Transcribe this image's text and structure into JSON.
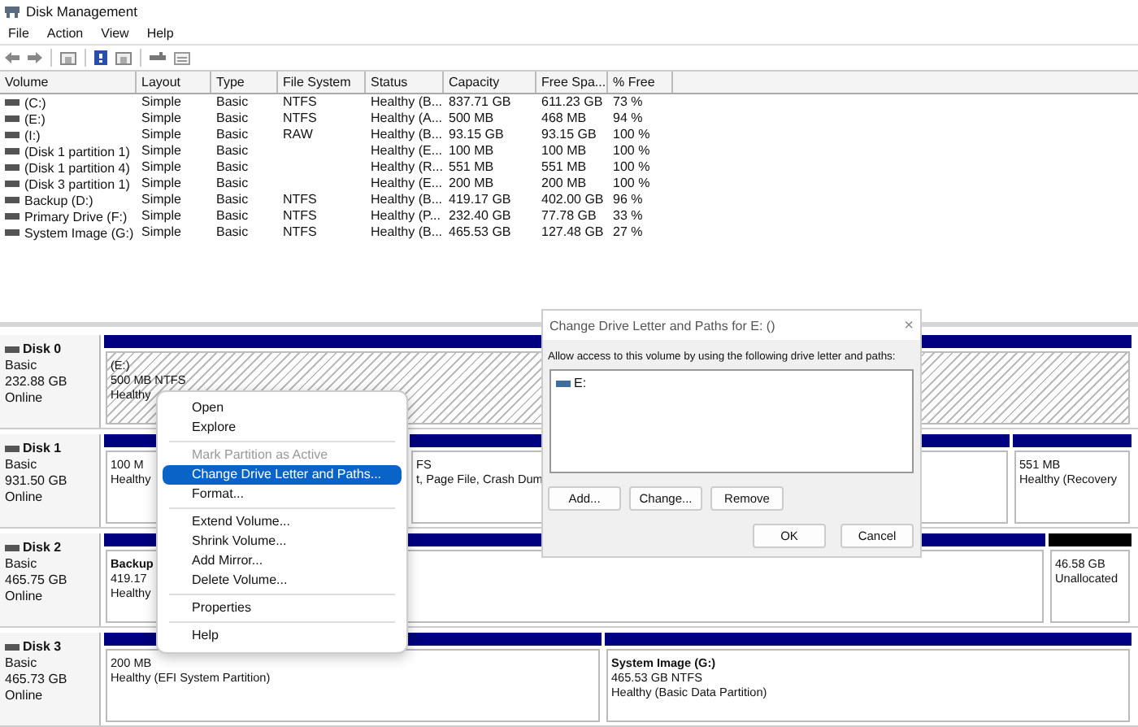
{
  "window": {
    "title": "Disk Management"
  },
  "menu": [
    "File",
    "Action",
    "View",
    "Help"
  ],
  "table": {
    "columns": [
      "Volume",
      "Layout",
      "Type",
      "File System",
      "Status",
      "Capacity",
      "Free Spa...",
      "% Free"
    ],
    "rows": [
      [
        "(C:)",
        "Simple",
        "Basic",
        "NTFS",
        "Healthy (B...",
        "837.71 GB",
        "611.23 GB",
        "73 %"
      ],
      [
        "(E:)",
        "Simple",
        "Basic",
        "NTFS",
        "Healthy (A...",
        "500 MB",
        "468 MB",
        "94 %"
      ],
      [
        "(I:)",
        "Simple",
        "Basic",
        "RAW",
        "Healthy (B...",
        "93.15 GB",
        "93.15 GB",
        "100 %"
      ],
      [
        "(Disk 1 partition 1)",
        "Simple",
        "Basic",
        "",
        "Healthy (E...",
        "100 MB",
        "100 MB",
        "100 %"
      ],
      [
        "(Disk 1 partition 4)",
        "Simple",
        "Basic",
        "",
        "Healthy (R...",
        "551 MB",
        "551 MB",
        "100 %"
      ],
      [
        "(Disk 3 partition 1)",
        "Simple",
        "Basic",
        "",
        "Healthy (E...",
        "200 MB",
        "200 MB",
        "100 %"
      ],
      [
        "Backup (D:)",
        "Simple",
        "Basic",
        "NTFS",
        "Healthy (B...",
        "419.17 GB",
        "402.00 GB",
        "96 %"
      ],
      [
        "Primary Drive (F:)",
        "Simple",
        "Basic",
        "NTFS",
        "Healthy (P...",
        "232.40 GB",
        "77.78 GB",
        "33 %"
      ],
      [
        "System Image (G:)",
        "Simple",
        "Basic",
        "NTFS",
        "Healthy (B...",
        "465.53 GB",
        "127.48 GB",
        "27 %"
      ]
    ]
  },
  "disks": [
    {
      "name": "Disk 0",
      "type": "Basic",
      "size": "232.88 GB",
      "status": "Online",
      "partitions": [
        {
          "kind": "primary",
          "selected": true,
          "lines": [
            "(E:)",
            "500 MB NTFS",
            "Healthy"
          ]
        }
      ]
    },
    {
      "name": "Disk 1",
      "type": "Basic",
      "size": "931.50 GB",
      "status": "Online",
      "partitions": [
        {
          "kind": "primary",
          "selected": false,
          "lines": [
            "100 M",
            "Healthy"
          ]
        },
        {
          "kind": "primary",
          "selected": false,
          "lines": [
            "FS",
            "t, Page File, Crash Dum"
          ]
        },
        {
          "kind": "primary",
          "selected": false,
          "lines": [
            "551 MB",
            "Healthy (Recovery"
          ]
        }
      ]
    },
    {
      "name": "Disk 2",
      "type": "Basic",
      "size": "465.75 GB",
      "status": "Online",
      "partitions": [
        {
          "kind": "primary",
          "selected": false,
          "title": "Backup",
          "lines": [
            "419.17",
            "Healthy"
          ]
        },
        {
          "kind": "unallocated",
          "selected": false,
          "lines": [
            "46.58 GB",
            "Unallocated"
          ]
        }
      ]
    },
    {
      "name": "Disk 3",
      "type": "Basic",
      "size": "465.73 GB",
      "status": "Online",
      "partitions": [
        {
          "kind": "primary",
          "selected": false,
          "lines": [
            "200 MB",
            "Healthy (EFI System Partition)"
          ]
        },
        {
          "kind": "primary",
          "selected": false,
          "title": "System Image  (G:)",
          "lines": [
            "465.53 GB NTFS",
            "Healthy (Basic Data Partition)"
          ]
        }
      ]
    }
  ],
  "context_menu": {
    "items": [
      {
        "kind": "item",
        "label": "Open",
        "disabled": false,
        "selected": false
      },
      {
        "kind": "item",
        "label": "Explore",
        "disabled": false,
        "selected": false
      },
      {
        "kind": "separator"
      },
      {
        "kind": "item",
        "label": "Mark Partition as Active",
        "disabled": true,
        "selected": false
      },
      {
        "kind": "item",
        "label": "Change Drive Letter and Paths...",
        "disabled": false,
        "selected": true
      },
      {
        "kind": "item",
        "label": "Format...",
        "disabled": false,
        "selected": false
      },
      {
        "kind": "separator"
      },
      {
        "kind": "item",
        "label": "Extend Volume...",
        "disabled": false,
        "selected": false
      },
      {
        "kind": "item",
        "label": "Shrink Volume...",
        "disabled": false,
        "selected": false
      },
      {
        "kind": "item",
        "label": "Add Mirror...",
        "disabled": false,
        "selected": false
      },
      {
        "kind": "item",
        "label": "Delete Volume...",
        "disabled": false,
        "selected": false
      },
      {
        "kind": "separator"
      },
      {
        "kind": "item",
        "label": "Properties",
        "disabled": false,
        "selected": false
      },
      {
        "kind": "separator"
      },
      {
        "kind": "item",
        "label": "Help",
        "disabled": false,
        "selected": false
      }
    ]
  },
  "dialog": {
    "title": "Change Drive Letter and Paths for E: ()",
    "close": "×",
    "prompt": "Allow access to this volume by using the following drive letter and paths:",
    "paths": [
      "E:"
    ],
    "buttons": [
      "Add...",
      "Change...",
      "Remove"
    ],
    "footer_buttons": [
      "OK",
      "Cancel"
    ]
  }
}
